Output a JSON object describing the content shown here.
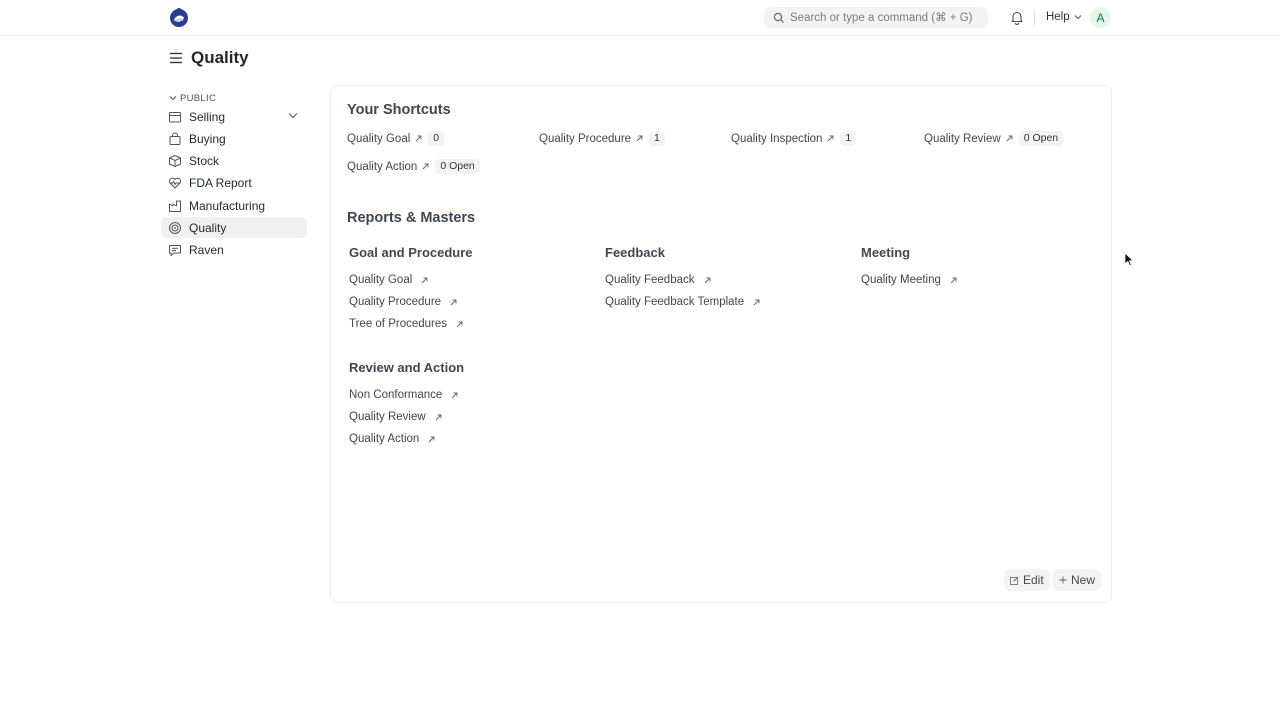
{
  "navbar": {
    "search_placeholder": "Search or type a command (⌘ + G)",
    "help_label": "Help",
    "avatar_initial": "A"
  },
  "page": {
    "title": "Quality"
  },
  "sidebar": {
    "section_label": "PUBLIC",
    "items": [
      {
        "label": "Selling",
        "icon": "storefront-icon",
        "has_chevron": true
      },
      {
        "label": "Buying",
        "icon": "shopping-bag-icon"
      },
      {
        "label": "Stock",
        "icon": "box-icon"
      },
      {
        "label": "FDA Report",
        "icon": "heart-pulse-icon"
      },
      {
        "label": "Manufacturing",
        "icon": "factory-icon"
      },
      {
        "label": "Quality",
        "icon": "target-icon",
        "active": true
      },
      {
        "label": "Raven",
        "icon": "chat-icon"
      }
    ]
  },
  "shortcuts": {
    "heading": "Your Shortcuts",
    "items": [
      {
        "label": "Quality Goal",
        "badge": "0"
      },
      {
        "label": "Quality Procedure",
        "badge": "1"
      },
      {
        "label": "Quality Inspection",
        "badge": "1"
      },
      {
        "label": "Quality Review",
        "badge": "0 Open"
      },
      {
        "label": "Quality Action",
        "badge": "0 Open"
      }
    ]
  },
  "reports": {
    "heading": "Reports & Masters",
    "groups": [
      {
        "title": "Goal and Procedure",
        "links": [
          "Quality Goal",
          "Quality Procedure",
          "Tree of Procedures"
        ]
      },
      {
        "title": "Feedback",
        "links": [
          "Quality Feedback",
          "Quality Feedback Template"
        ]
      },
      {
        "title": "Meeting",
        "links": [
          "Quality Meeting"
        ]
      },
      {
        "title": "Review and Action",
        "links": [
          "Non Conformance",
          "Quality Review",
          "Quality Action"
        ]
      }
    ]
  },
  "actions": {
    "edit_label": "Edit",
    "new_label": "New"
  }
}
